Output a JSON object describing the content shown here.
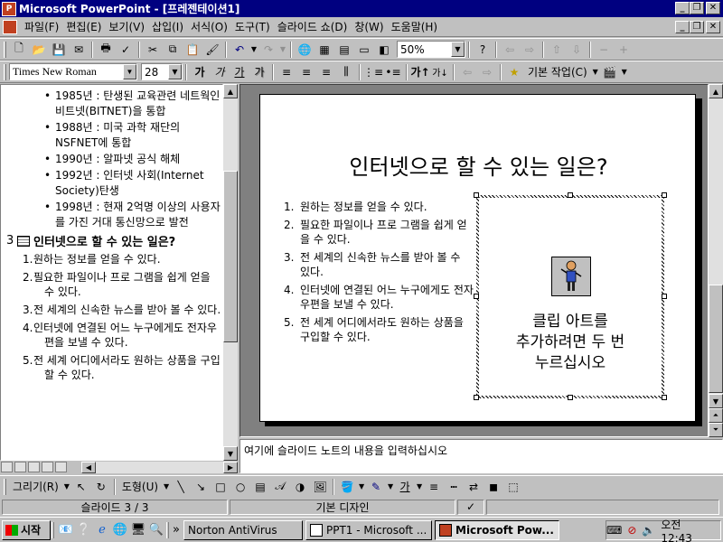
{
  "window": {
    "title": "Microsoft PowerPoint - [프레젠테이션1]",
    "minimize": "_",
    "restore": "❐",
    "close": "✕"
  },
  "menu": [
    "파일(F)",
    "편집(E)",
    "보기(V)",
    "삽입(I)",
    "서식(O)",
    "도구(T)",
    "슬라이드 쇼(D)",
    "창(W)",
    "도움말(H)"
  ],
  "toolbar": {
    "zoom": "50%"
  },
  "format_toolbar": {
    "font": "Times New Roman",
    "size": "28",
    "design_task": "기본 작업(C)"
  },
  "outline": {
    "bullets": [
      "1985년 : 탄생된 교육관련 네트웍인 비트넷(BITNET)을 통합",
      "1988년 : 미국 과학 재단의 NSFNET에 통합",
      "1990년 : 알파넷 공식 해체",
      "1992년 : 인터넷 사회(Internet Society)탄생",
      "1998년 : 현재 2억명 이상의 사용자를 가진 거대 통신망으로 발전"
    ],
    "slide_number": "3",
    "slide_title": "인터넷으로 할 수 있는 일은?",
    "items": [
      {
        "n": "1.",
        "text": "원하는 정보를 얻을 수 있다."
      },
      {
        "n": "2.",
        "text": "필요한  파일이나 프로 그램을 쉽게 얻을 수 있다."
      },
      {
        "n": "3.",
        "text": "전 세계의 신속한 뉴스를 받아 볼 수 있다."
      },
      {
        "n": "4.",
        "text": "인터넷에 연결된 어느 누구에게도 전자우편을 보낼 수 있다."
      },
      {
        "n": "5.",
        "text": "전 세계 어디에서라도 원하는 상품을 구입할 수 있다."
      }
    ]
  },
  "slide": {
    "title": "인터넷으로 할 수 있는 일은?",
    "items": [
      {
        "n": "1.",
        "text": "원하는 정보를 얻을 수 있다."
      },
      {
        "n": "2.",
        "text": "필요한  파일이나 프로 그램을 쉽게 얻을 수 있다."
      },
      {
        "n": "3.",
        "text": "전 세계의 신속한 뉴스를 받아 볼 수 있다."
      },
      {
        "n": "4.",
        "text": "인터넷에 연결된 어느 누구에게도 전자우편을 보낼 수 있다."
      },
      {
        "n": "5.",
        "text": "전 세계 어디에서라도 원하는 상품을 구입할 수 있다."
      }
    ],
    "clip_placeholder": [
      "클립 아트를",
      "추가하려면 두 번",
      "누르십시오"
    ]
  },
  "notes": {
    "placeholder": "여기에 슬라이드 노트의 내용을 입력하십시오"
  },
  "drawing": {
    "draw_label": "그리기(R)",
    "autoshape_label": "도형(U)"
  },
  "status": {
    "slide": "슬라이드 3 / 3",
    "design": "기본 디자인"
  },
  "taskbar": {
    "start": "시작",
    "tasks": [
      "Norton AntiVirus",
      "PPT1 - Microsoft ...",
      "Microsoft Pow..."
    ],
    "clock": "오전 12:43"
  }
}
